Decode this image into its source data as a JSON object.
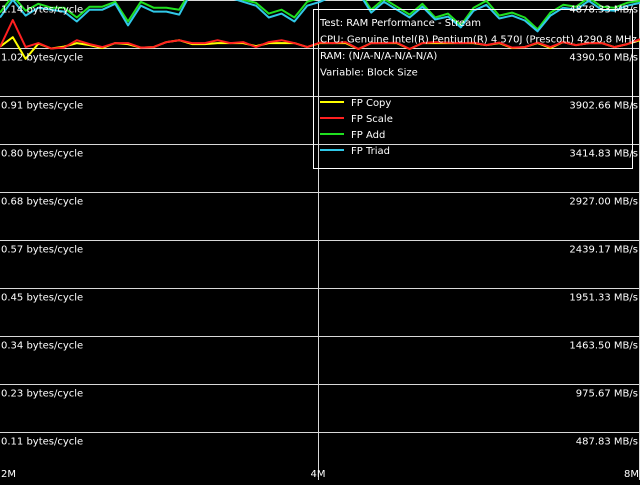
{
  "chart_data": {
    "type": "line",
    "x_unit": "bytes",
    "x_ticks": [
      "2M",
      "4M",
      "8M"
    ],
    "x_range": [
      "2M",
      "8M"
    ],
    "left_axis_labels": [
      "1.14 bytes/cycle",
      "1.02 bytes/cycle",
      "0.91 bytes/cycle",
      "0.80 bytes/cycle",
      "0.68 bytes/cycle",
      "0.57 bytes/cycle",
      "0.45 bytes/cycle",
      "0.34 bytes/cycle",
      "0.23 bytes/cycle",
      "0.11 bytes/cycle"
    ],
    "right_axis_labels": [
      "4878.33 MB/s",
      "4390.50 MB/s",
      "3902.66 MB/s",
      "3414.83 MB/s",
      "2927.00 MB/s",
      "2439.17 MB/s",
      "1951.33 MB/s",
      "1463.50 MB/s",
      "975.67 MB/s",
      "487.83 MB/s"
    ],
    "ylim_mbs": [
      0,
      4878.33
    ],
    "grid": true,
    "legend_placement": "top-right",
    "info_lines": [
      "Test: RAM Performance - Stream",
      "CPU: Genuine Intel(R) Pentium(R) 4 570J (Prescott) 4290.8 MHz",
      "RAM:  (N/A-N/A-N/A-N/A)",
      "Variable: Block Size"
    ],
    "series": [
      {
        "name": "FP Copy",
        "color": "#ffff00",
        "values": [
          4404,
          4500,
          4280,
          4435,
          4385,
          4405,
          4440,
          4420,
          4390,
          4440,
          4430,
          4395,
          4400,
          4450,
          4470,
          4430,
          4430,
          4440,
          4440,
          4440,
          4410,
          4440,
          4440,
          4440,
          4400,
          4440,
          4440,
          4440,
          4380,
          4440,
          4440,
          4440,
          4380,
          4440,
          4440,
          4440,
          4440,
          4440,
          4420,
          4440,
          4390,
          4400,
          4440,
          4390,
          4450,
          4420,
          4440,
          4440,
          4400,
          4430,
          4470
        ]
      },
      {
        "name": "FP Scale",
        "color": "#ff2020",
        "values": [
          4400,
          4675,
          4400,
          4440,
          4385,
          4395,
          4470,
          4430,
          4400,
          4440,
          4440,
          4395,
          4400,
          4450,
          4470,
          4440,
          4440,
          4470,
          4440,
          4450,
          4400,
          4450,
          4470,
          4440,
          4400,
          4445,
          4440,
          4450,
          4380,
          4440,
          4440,
          4445,
          4380,
          4440,
          4450,
          4445,
          4440,
          4445,
          4420,
          4445,
          4395,
          4400,
          4445,
          4400,
          4450,
          4420,
          4440,
          4440,
          4400,
          4430,
          4480
        ]
      },
      {
        "name": "FP Add",
        "color": "#20e020",
        "values": [
          4750,
          4920,
          4770,
          4840,
          4800,
          4800,
          4700,
          4810,
          4810,
          4860,
          4660,
          4860,
          4800,
          4800,
          4780,
          4990,
          4990,
          4940,
          4930,
          4880,
          4850,
          4740,
          4780,
          4700,
          4860,
          4900,
          4950,
          4960,
          4980,
          4780,
          4890,
          4810,
          4730,
          4840,
          4700,
          4740,
          4620,
          4800,
          4870,
          4720,
          4750,
          4700,
          4580,
          4750,
          4830,
          4810,
          4900,
          4810,
          4800,
          4850,
          4870
        ]
      },
      {
        "name": "FP Triad",
        "color": "#30c8e8",
        "values": [
          4700,
          4880,
          4720,
          4800,
          4780,
          4760,
          4660,
          4780,
          4780,
          4840,
          4620,
          4820,
          4760,
          4760,
          4730,
          4970,
          4970,
          4920,
          4900,
          4860,
          4820,
          4700,
          4740,
          4660,
          4820,
          4860,
          4920,
          4930,
          4960,
          4750,
          4860,
          4780,
          4700,
          4810,
          4680,
          4710,
          4600,
          4770,
          4830,
          4690,
          4720,
          4670,
          4560,
          4720,
          4800,
          4780,
          4870,
          4780,
          4770,
          4820,
          4850
        ]
      }
    ]
  }
}
